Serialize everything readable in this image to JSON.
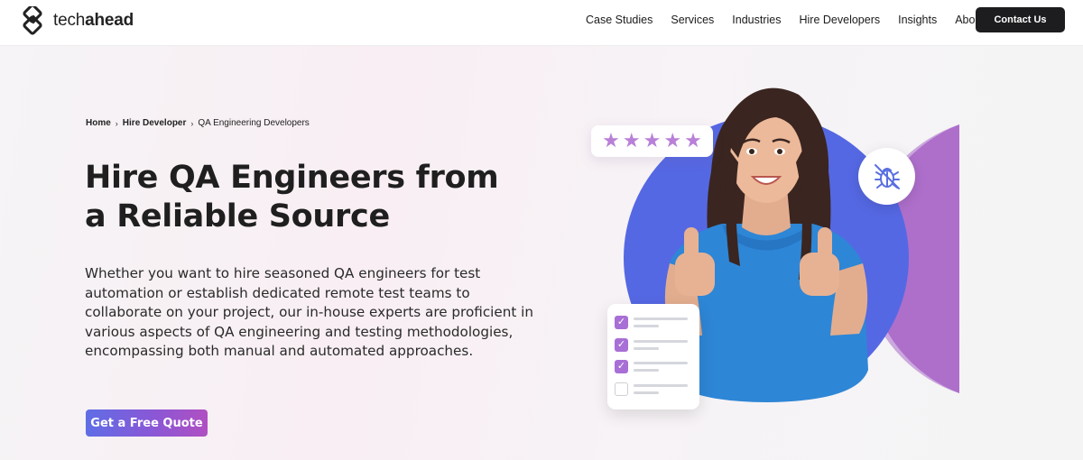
{
  "header": {
    "logo": {
      "light": "tech",
      "bold": "ahead"
    },
    "nav": [
      "Case Studies",
      "Services",
      "Industries",
      "Hire Developers",
      "Insights",
      "About"
    ],
    "contact_label": "Contact Us"
  },
  "breadcrumb": {
    "items": [
      "Home",
      "Hire Developer",
      "QA Engineering Developers"
    ],
    "separator": "›"
  },
  "hero": {
    "title": "Hire QA Engineers from a Reliable Source",
    "description": "Whether you want to hire seasoned QA engineers for test automation or establish dedicated remote test teams to collaborate on your project, our in-house experts are proficient in various aspects of QA engineering and testing methodologies, encompassing both manual and automated approaches.",
    "cta_label": "Get a Free Quote"
  },
  "illustration": {
    "rating": 5,
    "star_glyph": "★",
    "checklist": [
      true,
      true,
      true,
      false
    ],
    "check_glyph": "✓",
    "icons": [
      "star-icon",
      "bug-icon",
      "checkbox-icon"
    ],
    "colors": {
      "circle_blue": "#5568e3",
      "circle_purple": "#b777cf",
      "star": "#b980d8",
      "check": "#a86fd6",
      "shirt": "#2e86d6"
    }
  },
  "colors": {
    "cta_gradient_start": "#5f6ee6",
    "cta_gradient_end": "#b050c2",
    "contact_bg": "#1d1d1f"
  }
}
